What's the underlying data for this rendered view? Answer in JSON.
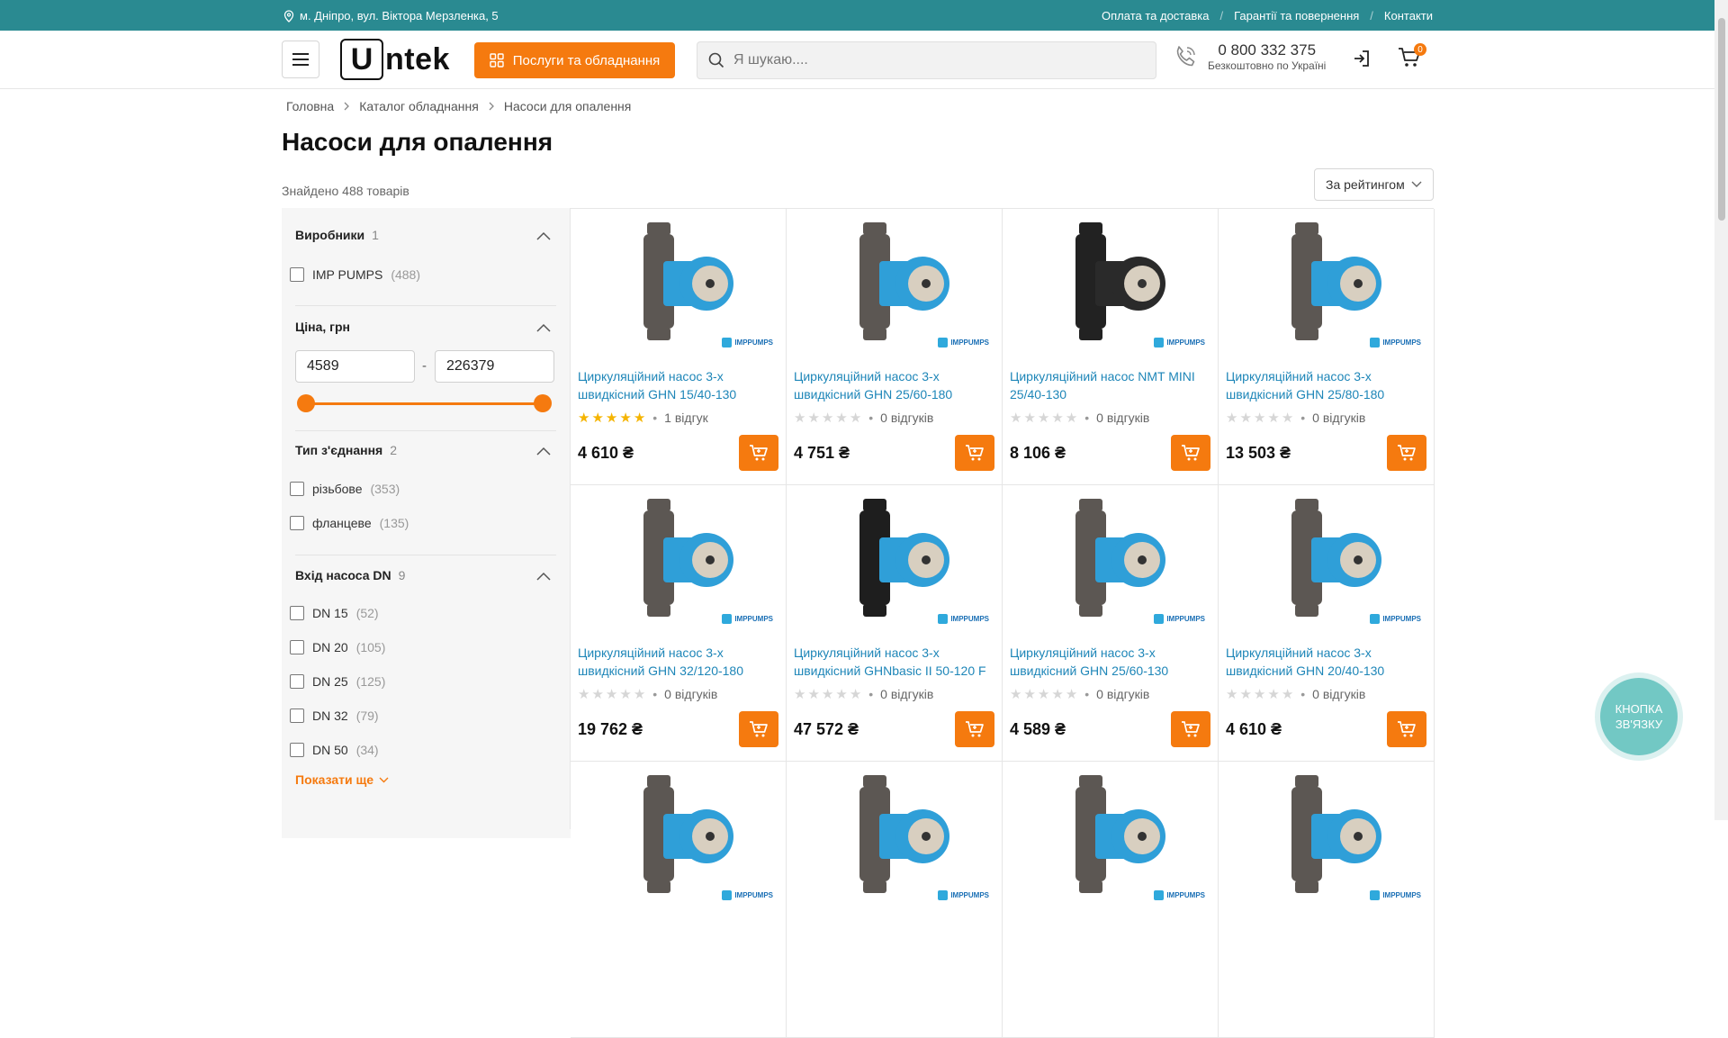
{
  "topbar": {
    "address": "м. Дніпро, вул. Віктора Мерзленка, 5",
    "links": [
      "Оплата та доставка",
      "Гарантії та повернення",
      "Контакти"
    ],
    "separator": "/"
  },
  "header": {
    "logo_letter": "U",
    "logo_text": "ntek",
    "services_label": "Послуги та обладнання",
    "search_placeholder": "Я шукаю....",
    "phone": "0 800 332 375",
    "phone_note": "Безкоштовно по Україні",
    "cart_count": "0"
  },
  "breadcrumb": [
    "Головна",
    "Каталог обладнання",
    "Насоси для опалення"
  ],
  "page_title": "Насоси для опалення",
  "found_text": "Знайдено 488 товарів",
  "sort_label": "За рейтингом",
  "filters": {
    "manufacturers": {
      "title": "Виробники",
      "count": "1",
      "items": [
        {
          "label": "IMP PUMPS",
          "count": "(488)"
        }
      ]
    },
    "price": {
      "title": "Ціна, грн",
      "min": "4589",
      "max": "226379",
      "dash": "-"
    },
    "connection": {
      "title": "Тип з'єднання",
      "count": "2",
      "items": [
        {
          "label": "різьбове",
          "count": "(353)"
        },
        {
          "label": "фланцеве",
          "count": "(135)"
        }
      ]
    },
    "inlet": {
      "title": "Вхід насоса DN",
      "count": "9",
      "items": [
        {
          "label": "DN 15",
          "count": "(52)"
        },
        {
          "label": "DN 20",
          "count": "(105)"
        },
        {
          "label": "DN 25",
          "count": "(125)"
        },
        {
          "label": "DN 32",
          "count": "(79)"
        },
        {
          "label": "DN 50",
          "count": "(34)"
        }
      ]
    },
    "show_more": "Показати ще"
  },
  "products": [
    {
      "name": "Циркуляційний насос 3-х швидкісний GHN 15/40-130",
      "rating": 5,
      "reviews": "1 відгук",
      "price": "4 610 ₴",
      "body_color": "#2f9fd8",
      "base_color": "#5c5753"
    },
    {
      "name": "Циркуляційний насос 3-х швидкісний GHN 25/60-180",
      "rating": 0,
      "reviews": "0 відгуків",
      "price": "4 751 ₴",
      "body_color": "#2f9fd8",
      "base_color": "#5c5753"
    },
    {
      "name": "Циркуляційний насос NMT MINI 25/40-130",
      "rating": 0,
      "reviews": "0 відгуків",
      "price": "8 106 ₴",
      "body_color": "#2a2a2a",
      "base_color": "#222222"
    },
    {
      "name": "Циркуляційний насос 3-х швидкісний GHN 25/80-180",
      "rating": 0,
      "reviews": "0 відгуків",
      "price": "13 503 ₴",
      "body_color": "#2f9fd8",
      "base_color": "#5c5753"
    },
    {
      "name": "Циркуляційний насос 3-х швидкісний GHN 32/120-180",
      "rating": 0,
      "reviews": "0 відгуків",
      "price": "19 762 ₴",
      "body_color": "#2f9fd8",
      "base_color": "#5c5753"
    },
    {
      "name": "Циркуляційний насос 3-х швидкісний GHNbasic II 50-120 F",
      "rating": 0,
      "reviews": "0 відгуків",
      "price": "47 572 ₴",
      "body_color": "#2f9fd8",
      "base_color": "#1e1e1e"
    },
    {
      "name": "Циркуляційний насос 3-х швидкісний GHN 25/60-130",
      "rating": 0,
      "reviews": "0 відгуків",
      "price": "4 589 ₴",
      "body_color": "#2f9fd8",
      "base_color": "#5c5753"
    },
    {
      "name": "Циркуляційний насос 3-х швидкісний GHN 20/40-130",
      "rating": 0,
      "reviews": "0 відгуків",
      "price": "4 610 ₴",
      "body_color": "#2f9fd8",
      "base_color": "#5c5753"
    }
  ],
  "brand_label": "IMPPUMPS",
  "contact_button": "КНОПКА ЗВ'ЯЗКУ",
  "colors": {
    "accent": "#f57a0f",
    "topbar": "#2a8a91",
    "link": "#1e86b8",
    "contact": "#72c8c4"
  }
}
